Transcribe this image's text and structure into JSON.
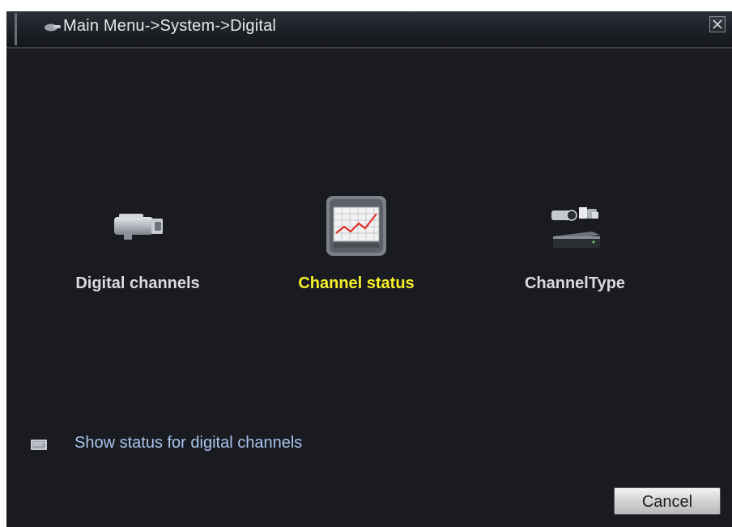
{
  "window": {
    "breadcrumb": "Main Menu->System->Digital",
    "close_symbol": "×"
  },
  "menu": {
    "items": [
      {
        "label": "Digital channels",
        "icon": "camera-icon",
        "selected": false
      },
      {
        "label": "Channel status",
        "icon": "chart-monitor-icon",
        "selected": true
      },
      {
        "label": "ChannelType",
        "icon": "camera-dvr-icon",
        "selected": false
      }
    ]
  },
  "status": {
    "text": "Show status for digital channels",
    "icon": "info-card-icon"
  },
  "buttons": {
    "cancel": "Cancel"
  },
  "colors": {
    "background": "#191b20",
    "selected_label": "#f5f02a",
    "status_text": "#a9c4ee"
  }
}
